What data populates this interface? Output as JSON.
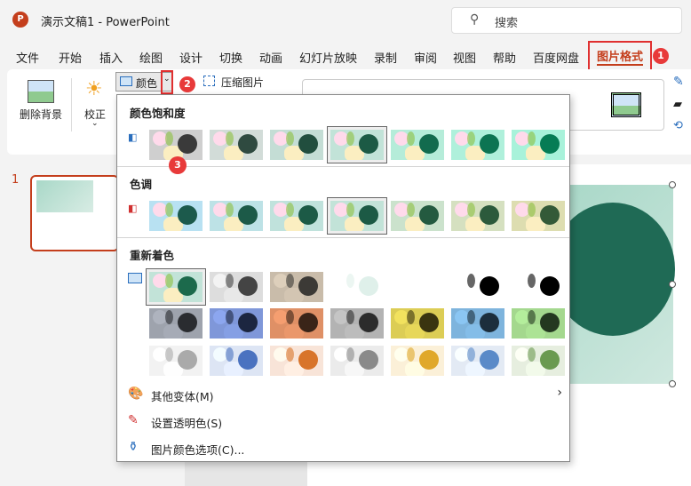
{
  "titlebar": {
    "doc_title": "演示文稿1  -  PowerPoint",
    "logo": "P",
    "search_placeholder": "搜索"
  },
  "tabs": [
    "文件",
    "开始",
    "插入",
    "绘图",
    "设计",
    "切换",
    "动画",
    "幻灯片放映",
    "录制",
    "审阅",
    "视图",
    "帮助",
    "百度网盘"
  ],
  "active_tab": "图片格式",
  "badges": [
    "1",
    "2",
    "3"
  ],
  "ribbon": {
    "remove_bg": "删除背景",
    "correct": "校正",
    "color": "颜色",
    "compress": "压缩图片"
  },
  "slides": {
    "number": "1"
  },
  "dropdown": {
    "saturation_title": "颜色饱和度",
    "tone_title": "色调",
    "recolor_title": "重新着色",
    "saturation": [
      {
        "bg": "#cfcfcf",
        "c": "#3a3a3a",
        "sat": 0
      },
      {
        "bg": "#d2dcd8",
        "c": "#2f4a40",
        "sat": 33
      },
      {
        "bg": "#c4ddd5",
        "c": "#214e3e",
        "sat": 66
      },
      {
        "bg": "#c2e3d8",
        "c": "#1c5a45",
        "sat": 100,
        "selected": true
      },
      {
        "bg": "#b5ecd9",
        "c": "#126b4e",
        "sat": 200
      },
      {
        "bg": "#aff0db",
        "c": "#0c7452",
        "sat": 300
      },
      {
        "bg": "#a8f2da",
        "c": "#067c55",
        "sat": 400
      }
    ],
    "tone": [
      {
        "bg": "#b8e1f2",
        "c": "#1c5a4c",
        "temp": 4700
      },
      {
        "bg": "#bde2e6",
        "c": "#1c5a48",
        "temp": 5300
      },
      {
        "bg": "#c0e2dc",
        "c": "#1c5a46",
        "temp": 5900
      },
      {
        "bg": "#c2e3d8",
        "c": "#1c5a45",
        "temp": 6500,
        "selected": true
      },
      {
        "bg": "#cbe2cc",
        "c": "#245a40",
        "temp": 7200
      },
      {
        "bg": "#d5e0c0",
        "c": "#2c5a3c",
        "temp": 8800
      },
      {
        "bg": "#ddddb0",
        "c": "#345a38",
        "temp": 11200
      }
    ],
    "recolor": [
      {
        "bg": "#c2e3d8",
        "c": "#1c6a4c",
        "selected": true
      },
      {
        "bg": "#dddddd",
        "c": "#444444"
      },
      {
        "bg": "#c9bcaa",
        "c": "#3c3a36"
      },
      {
        "bg": "#ffffff",
        "c": "#dff0ea"
      },
      {
        "bg": "#ffffff",
        "c": "#ffffff"
      },
      {
        "bg": "#ffffff",
        "c": "#000000"
      },
      {
        "bg": "#ffffff",
        "c": "#000000"
      },
      {
        "bg": "#9ea3ad",
        "c": "#2a2c30"
      },
      {
        "bg": "#7f97d9",
        "c": "#1c2640"
      },
      {
        "bg": "#df9066",
        "c": "#3a2418"
      },
      {
        "bg": "#b3b3b3",
        "c": "#2c2c2c"
      },
      {
        "bg": "#dccd55",
        "c": "#3a3410"
      },
      {
        "bg": "#7eb4dd",
        "c": "#1c2e3c"
      },
      {
        "bg": "#a4d88e",
        "c": "#243820"
      },
      {
        "bg": "#f2f2f2",
        "c": "#aaaaaa"
      },
      {
        "bg": "#dde5f4",
        "c": "#4a72c0"
      },
      {
        "bg": "#f8e4d8",
        "c": "#d8742a"
      },
      {
        "bg": "#ebebeb",
        "c": "#8a8a8a"
      },
      {
        "bg": "#fbf0d8",
        "c": "#e0a82a"
      },
      {
        "bg": "#e3eaf4",
        "c": "#5a8ac8"
      },
      {
        "bg": "#e6eedf",
        "c": "#6a9a50"
      }
    ],
    "menu": [
      "其他变体(M)",
      "设置透明色(S)",
      "图片颜色选项(C)..."
    ]
  },
  "colors": {
    "accent": "#c43e1c",
    "highlight": "#e03030"
  }
}
